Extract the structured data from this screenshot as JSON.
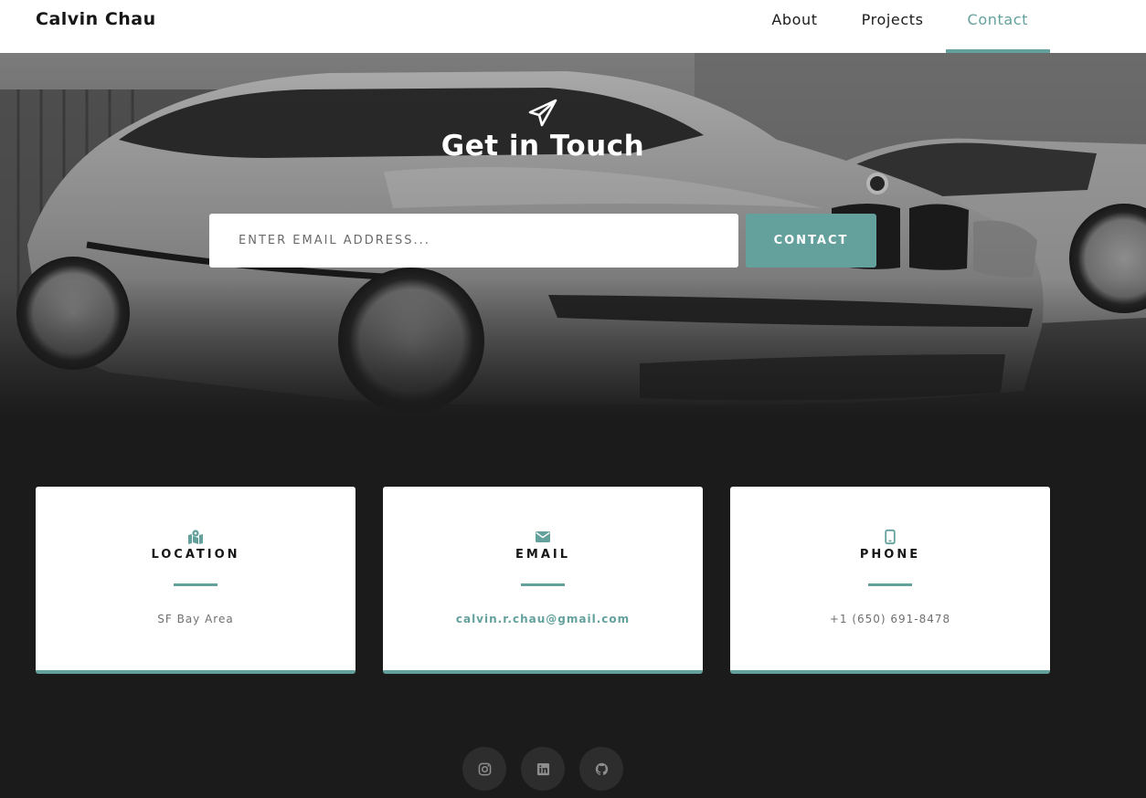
{
  "brand": {
    "name": "Calvin Chau"
  },
  "nav": {
    "about": "About",
    "projects": "Projects",
    "contact": "Contact"
  },
  "hero": {
    "title": "Get in Touch",
    "email_placeholder": "ENTER EMAIL ADDRESS...",
    "button_label": "CONTACT",
    "icon": "paper-plane-icon"
  },
  "cards": [
    {
      "icon": "map-marked-icon",
      "title": "LOCATION",
      "value": "SF Bay Area"
    },
    {
      "icon": "envelope-icon",
      "title": "EMAIL",
      "value": "calvin.r.chau@gmail.com"
    },
    {
      "icon": "mobile-phone-icon",
      "title": "PHONE",
      "value": "+1 (650) 691-8478"
    }
  ],
  "social": [
    "instagram-icon",
    "linkedin-icon",
    "github-icon"
  ],
  "colors": {
    "accent": "#64a19d",
    "page_background": "#1b1b1c",
    "card_background": "#ffffff",
    "social_button": "#2d2d2d"
  }
}
